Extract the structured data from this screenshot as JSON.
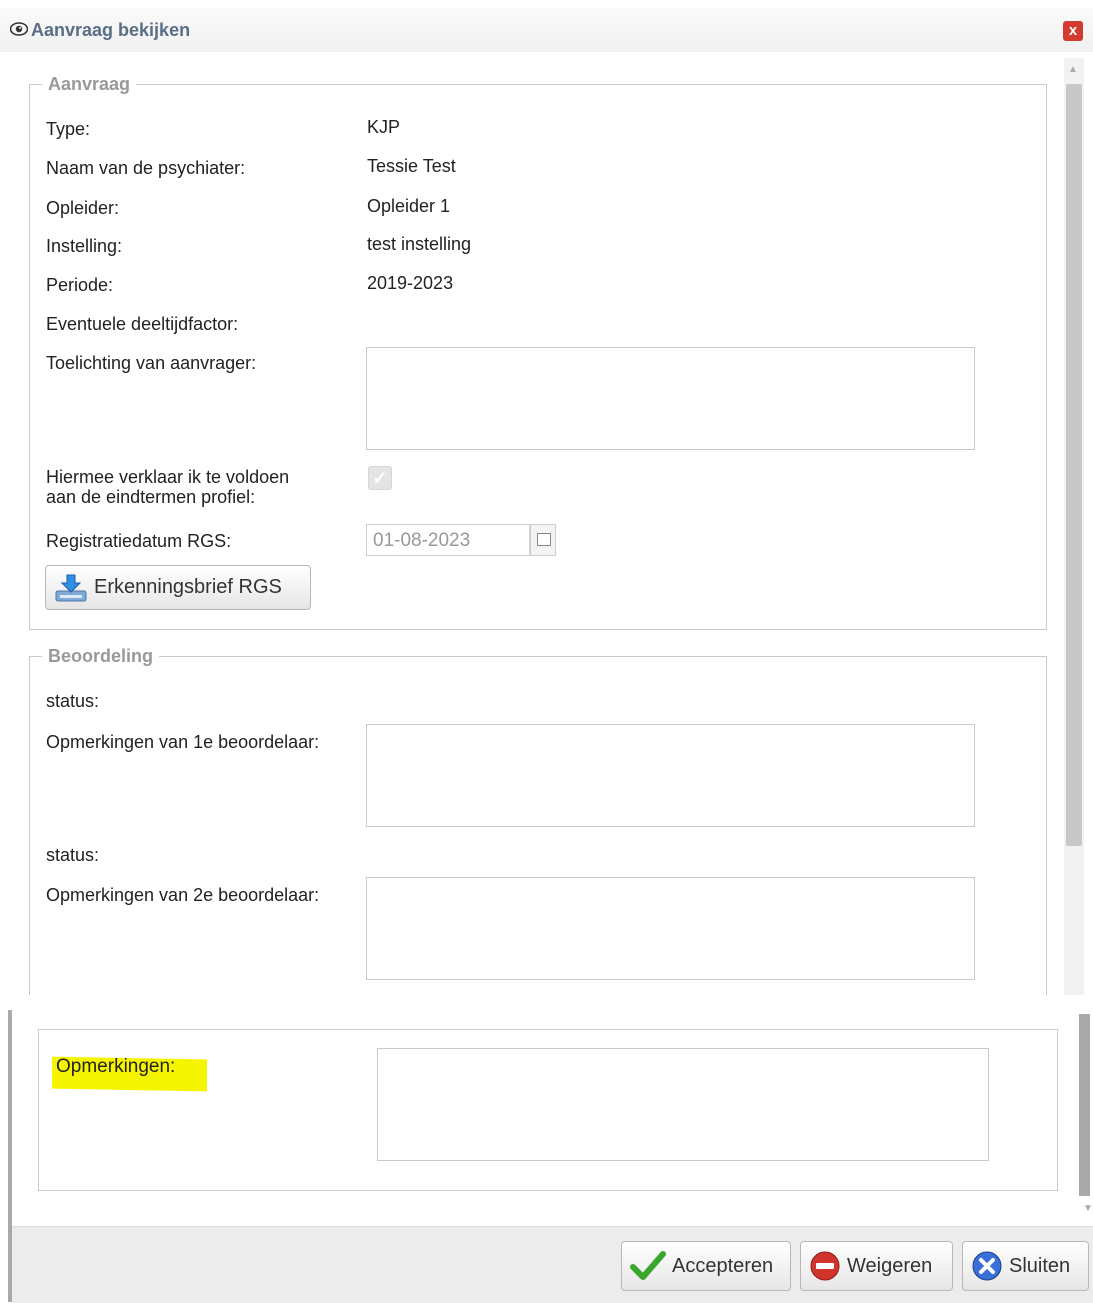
{
  "dialog": {
    "title": "Aanvraag bekijken",
    "close_label": "x"
  },
  "aanvraag": {
    "legend": "Aanvraag",
    "fields": [
      {
        "label": "Type:",
        "value": "KJP"
      },
      {
        "label": "Naam van de psychiater:",
        "value": "Tessie Test"
      },
      {
        "label": "Opleider:",
        "value": "Opleider 1"
      },
      {
        "label": "Instelling:",
        "value": "test instelling"
      },
      {
        "label": "Periode:",
        "value": "2019-2023"
      },
      {
        "label": "Eventuele deeltijdfactor:",
        "value": ""
      }
    ],
    "toelichting_label": "Toelichting van aanvrager:",
    "toelichting_value": "",
    "verklaar_line1": "Hiermee verklaar ik te voldoen",
    "verklaar_line2": "aan de eindtermen profiel:",
    "verklaar_checked": true,
    "registratiedatum_label": "Registratiedatum RGS:",
    "registratiedatum_value": "01-08-2023",
    "erkenningsbrief_label": "Erkenningsbrief RGS"
  },
  "beoordeling": {
    "legend": "Beoordeling",
    "status1_label": "status:",
    "opm1_label": "Opmerkingen van 1e beoordelaar:",
    "status2_label": "status:",
    "opm2_label": "Opmerkingen van 2e beoordelaar:"
  },
  "opmerkingen": {
    "label": "Opmerkingen:",
    "highlight_color": "#f6f500"
  },
  "footer": {
    "accept_label": "Accepteren",
    "reject_label": "Weigeren",
    "close_label": "Sluiten"
  },
  "icons": {
    "title": "eye-icon",
    "close": "close-icon",
    "download": "download-icon",
    "accept": "checkmark-icon",
    "reject": "minus-circle-icon",
    "close_footer": "x-circle-icon",
    "calendar": "calendar-icon"
  },
  "colors": {
    "title": "#5a6e86",
    "close": "#d23b2f",
    "accept": "#3aa62e",
    "reject": "#d0342c",
    "sluiten": "#3a6fd8"
  }
}
